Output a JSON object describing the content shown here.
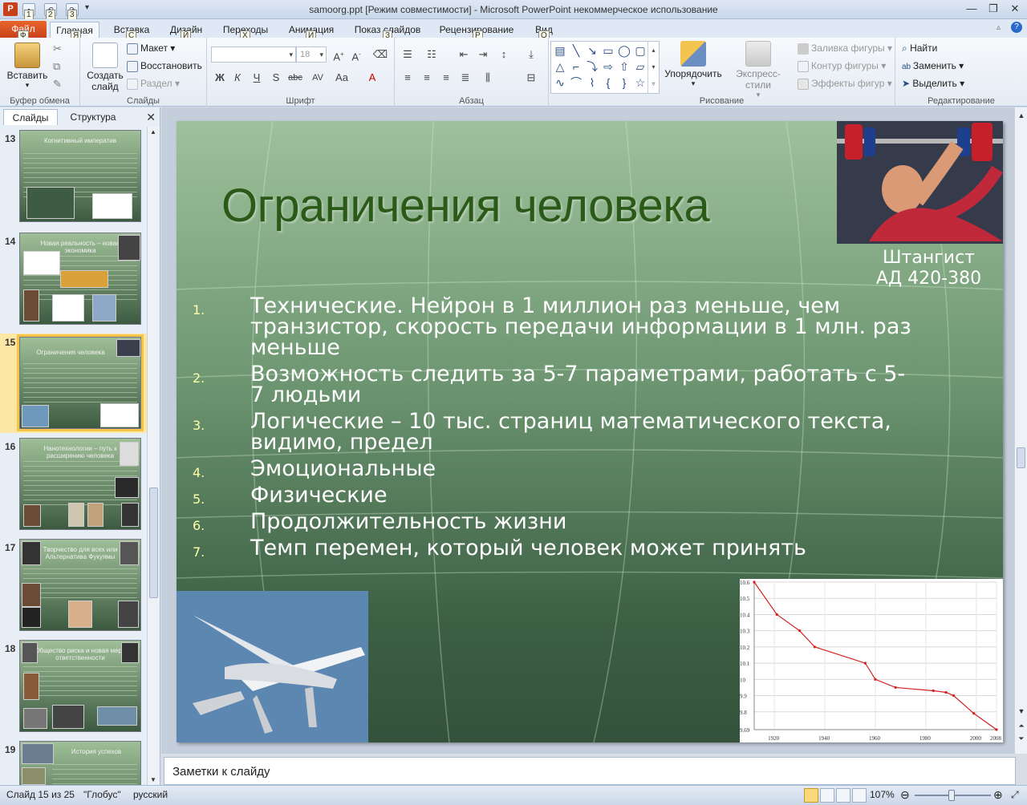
{
  "window": {
    "title": "samoorg.ppt [Режим совместимости]  -  Microsoft PowerPoint некоммерческое использование",
    "app_letter": "P",
    "qat_keytips": [
      "1",
      "2",
      "3"
    ]
  },
  "ribbon_tabs": [
    {
      "label": "Файл",
      "keytip": "Ф"
    },
    {
      "label": "Главная",
      "keytip": "Я"
    },
    {
      "label": "Вставка",
      "keytip": "С"
    },
    {
      "label": "Дизайн",
      "keytip": "Й"
    },
    {
      "label": "Переходы",
      "keytip": "Х"
    },
    {
      "label": "Анимация",
      "keytip": "И"
    },
    {
      "label": "Показ слайдов",
      "keytip": "З"
    },
    {
      "label": "Рецензирование",
      "keytip": "Р"
    },
    {
      "label": "Вид",
      "keytip": "О"
    }
  ],
  "ribbon": {
    "clipboard": {
      "paste": "Вставить",
      "label": "Буфер обмена"
    },
    "slides": {
      "create": "Создать",
      "create2": "слайд",
      "layout": "Макет",
      "reset": "Восстановить",
      "section": "Раздел",
      "label": "Слайды"
    },
    "font": {
      "size": "18",
      "label": "Шрифт",
      "buttons": [
        "Ж",
        "К",
        "Ч",
        "S",
        "abc",
        "AV",
        "Aa",
        "A"
      ]
    },
    "paragraph": {
      "label": "Абзац"
    },
    "drawing": {
      "arrange": "Упорядочить",
      "styles": "Экспресс-стили",
      "fill": "Заливка фигуры",
      "outline": "Контур фигуры",
      "effects": "Эффекты фигур",
      "label": "Рисование"
    },
    "editing": {
      "find": "Найти",
      "replace": "Заменить",
      "select": "Выделить",
      "label": "Редактирование"
    }
  },
  "panel": {
    "tabs": [
      "Слайды",
      "Структура"
    ],
    "thumbnails": [
      {
        "num": "13",
        "title": "Когнитивный императив"
      },
      {
        "num": "14",
        "title": "Новая  реальность  – новая экономика"
      },
      {
        "num": "15",
        "title": "Ограничения человека"
      },
      {
        "num": "16",
        "title": "Нанотехнологии  – путь к расширению  человека"
      },
      {
        "num": "17",
        "title": "Творчество  для всех или Альтернатива Фукуямы"
      },
      {
        "num": "18",
        "title": "Общество  риска и новая мера ответственности"
      },
      {
        "num": "19",
        "title": "История успехов"
      }
    ]
  },
  "slide": {
    "title": "Ограничения человека",
    "caption_line1": "Штангист",
    "caption_line2": "АД 420-380",
    "items": [
      {
        "num": "1.",
        "text": "Технические. Нейрон в 1 миллион раз меньше, чем транзистор, скорость передачи информации в 1 млн. раз меньше"
      },
      {
        "num": "2.",
        "text": "Возможность следить за 5-7 параметрами, работать с 5-7 людьми"
      },
      {
        "num": "3.",
        "text": "Логические – 10 тыс. страниц математического текста, видимо, предел"
      },
      {
        "num": "4.",
        "text": "Эмоциональные"
      },
      {
        "num": "5.",
        "text": "Физические"
      },
      {
        "num": "6.",
        "text": "Продолжительность жизни"
      },
      {
        "num": "7.",
        "text": "Темп перемен, который человек может принять"
      }
    ]
  },
  "chart_data": {
    "type": "line",
    "x": [
      1912,
      1921,
      1930,
      1936,
      1956,
      1960,
      1968,
      1983,
      1988,
      1991,
      1999,
      2008
    ],
    "series": [
      {
        "values": [
          10.6,
          10.4,
          10.3,
          10.2,
          10.1,
          10.0,
          9.95,
          9.93,
          9.92,
          9.9,
          9.79,
          9.69
        ]
      }
    ],
    "xticks": [
      "1920",
      "1940",
      "1960",
      "1980",
      "2000",
      "2008"
    ],
    "yticks": [
      "10.6",
      "10.5",
      "10.4",
      "10.3",
      "10.2",
      "10.1",
      "10",
      "9.9",
      "9.8",
      "9.69"
    ],
    "xlim": [
      1912,
      2008
    ],
    "ylim": [
      9.69,
      10.6
    ],
    "grid": true,
    "line_color": "#d42020"
  },
  "notes": {
    "placeholder": "Заметки к слайду"
  },
  "status": {
    "slide": "Слайд 15 из 25",
    "theme": "\"Глобус\"",
    "lang": "русский",
    "zoom": "107%"
  }
}
